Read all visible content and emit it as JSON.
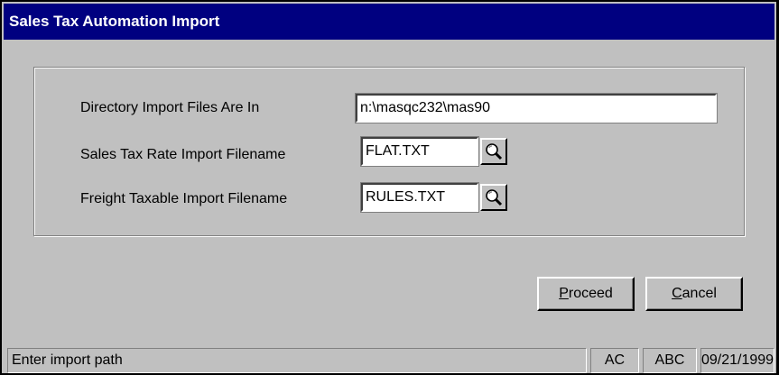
{
  "window": {
    "title": "Sales Tax Automation Import"
  },
  "form": {
    "directory": {
      "label": "Directory Import Files Are In",
      "value": "n:\\masqc232\\mas90"
    },
    "rate_file": {
      "label": "Sales Tax Rate Import Filename",
      "value": "FLAT.TXT"
    },
    "freight_file": {
      "label": "Freight Taxable Import Filename",
      "value": "RULES.TXT"
    }
  },
  "buttons": {
    "proceed": {
      "accel": "P",
      "rest": "roceed"
    },
    "cancel": {
      "accel": "C",
      "rest": "ancel"
    }
  },
  "statusbar": {
    "message": "Enter import path",
    "company": "AC",
    "mode": "ABC",
    "date": "09/21/1999"
  },
  "icons": {
    "lookup": "magnifier-icon"
  }
}
